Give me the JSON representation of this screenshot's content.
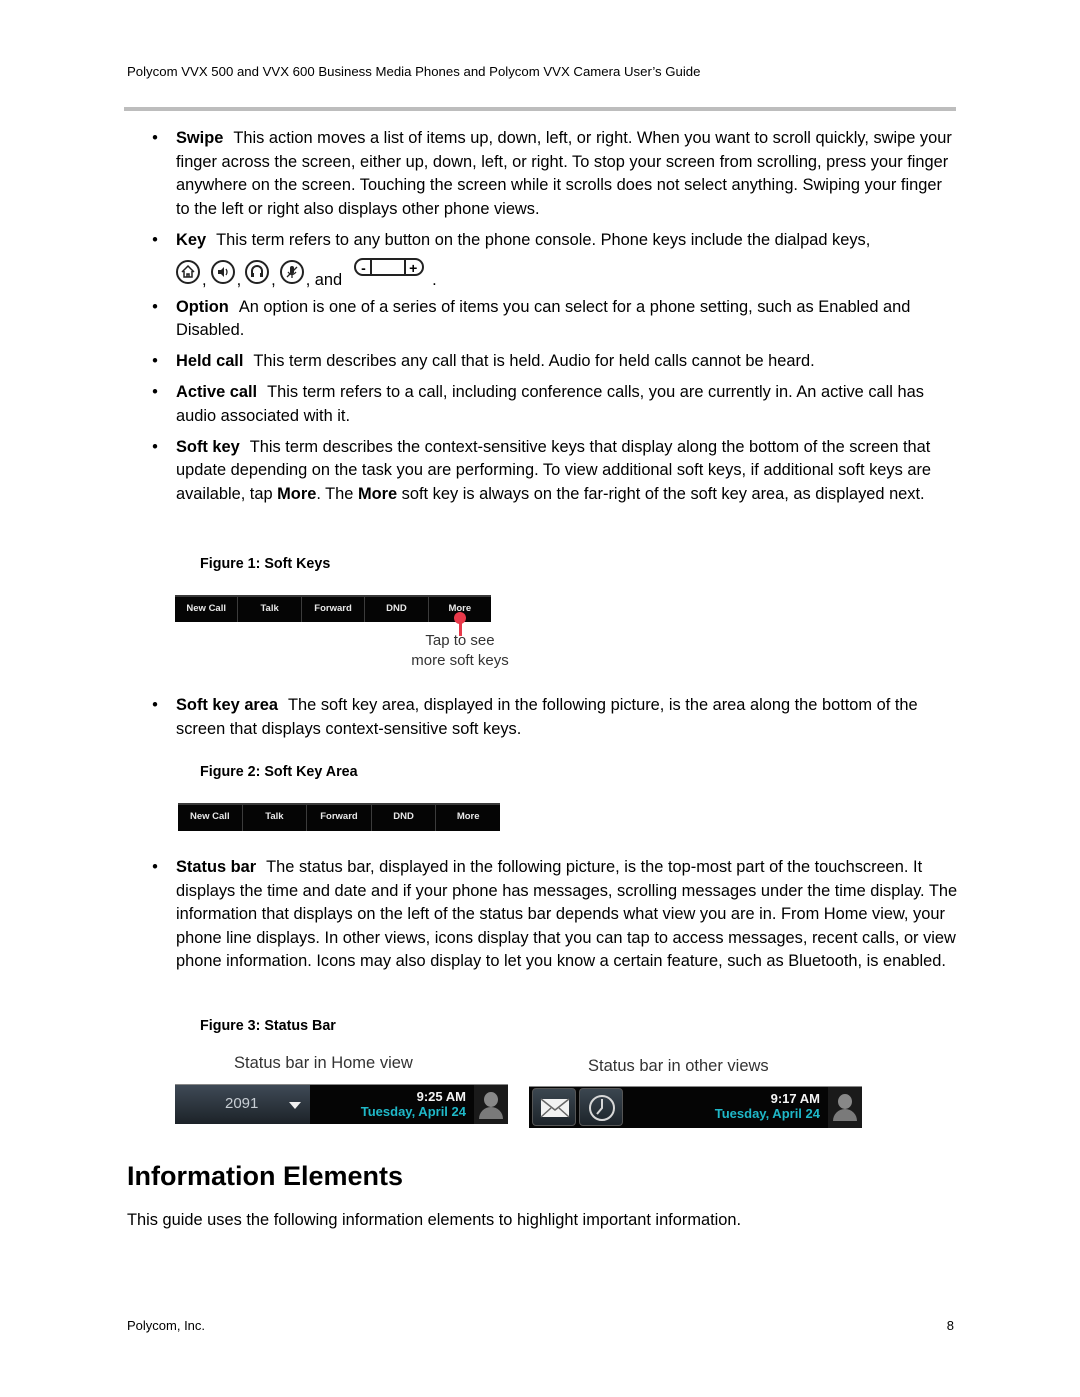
{
  "header": {
    "running_title": "Polycom VVX 500 and VVX 600 Business Media Phones and Polycom VVX Camera User’s Guide"
  },
  "bullets": [
    {
      "term": "Swipe",
      "text": "This action moves a list of items up, down, left, or right. When you want to scroll quickly, swipe your finger across the screen, either up, down, left, or right. To stop your screen from scrolling, press your finger anywhere on the screen. Touching the screen while it scrolls does not select anything. Swiping your finger to the left or right also displays other phone views."
    },
    {
      "term": "Key",
      "text": "This term refers to any button on the phone console. Phone keys include the dialpad keys,",
      "icons": [
        "home-key-icon",
        "speakerphone-key-icon",
        "headset-key-icon",
        "mute-key-icon",
        "volume-key-icon"
      ],
      "and_label": ", and",
      "end": "."
    },
    {
      "term": "Option",
      "text": "An option is one of a series of items you can select for a phone setting, such as Enabled and Disabled."
    },
    {
      "term": "Held call",
      "text": "This term describes any call that is held. Audio for held calls cannot be heard."
    },
    {
      "term": "Active call",
      "text": "This term refers to a call, including conference calls, you are currently in. An active call has audio associated with it."
    },
    {
      "term": "Soft key",
      "text_parts": [
        "This term describes the context-sensitive keys that display along the bottom of the screen that update depending on the task you are performing. To view additional soft keys, if additional soft keys are available, tap ",
        "More",
        ". The ",
        "More",
        " soft key is always on the far-right of the soft key area, as displayed next."
      ]
    },
    {
      "term": "Soft key area",
      "text": "The soft key area, displayed in the following picture, is the area along the bottom of the screen that displays context-sensitive soft keys."
    },
    {
      "term": "Status bar",
      "text": "The status bar, displayed in the following picture, is the top-most part of the touchscreen. It displays the time and date and if your phone has messages, scrolling messages under the time display. The information that displays on the left of the status bar depends what view you are in. From Home view, your phone line displays. In other views, icons display that you can tap to access messages, recent calls, or view phone information. Icons may also display to let you know a certain feature, such as Bluetooth, is enabled."
    }
  ],
  "figure1": {
    "caption": "Figure 1: Soft Keys",
    "soft_keys": [
      "New Call",
      "Talk",
      "Forward",
      "DND",
      "More"
    ],
    "callout_line1": "Tap to see",
    "callout_line2": "more soft keys",
    "callout_color": "#e8394a"
  },
  "figure2": {
    "caption": "Figure 2: Soft Key Area",
    "soft_keys": [
      "New Call",
      "Talk",
      "Forward",
      "DND",
      "More"
    ]
  },
  "figure3": {
    "caption": "Figure 3: Status Bar",
    "home": {
      "label": "Status bar in Home view",
      "line": "2091",
      "time": "9:25 AM",
      "date": "Tuesday, April 24"
    },
    "other": {
      "label": "Status bar in other views",
      "icons": [
        "messages-icon",
        "recent-calls-clock-icon"
      ],
      "time": "9:17 AM",
      "date": "Tuesday, April 24"
    },
    "date_color": "#1fb8c8"
  },
  "section": {
    "heading": "Information Elements",
    "body": "This guide uses the following information elements to highlight important information."
  },
  "footer": {
    "company": "Polycom, Inc.",
    "page_number": "8"
  }
}
